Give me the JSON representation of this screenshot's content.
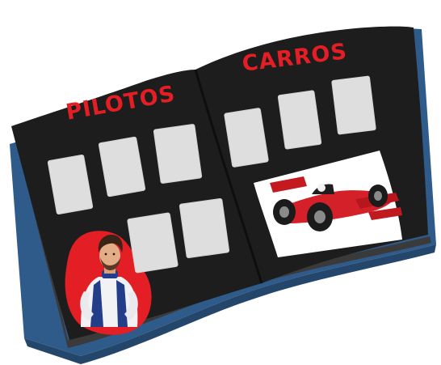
{
  "album": {
    "left_page": {
      "title": "PILOTOS"
    },
    "right_page": {
      "title": "CARROS"
    }
  },
  "colors": {
    "cover": "#2f5b8a",
    "cover_dark": "#24466b",
    "page": "#1d1d1d",
    "page_edge": "#3a3a3a",
    "title": "#e31e24",
    "slot": "#dedede",
    "card_bg": "#ffffff",
    "badge": "#e31e24"
  },
  "stickers": [
    {
      "name": "pilot-sticker",
      "icon": "racing-driver-illustration"
    },
    {
      "name": "car-sticker",
      "icon": "f1-race-car-illustration"
    }
  ]
}
